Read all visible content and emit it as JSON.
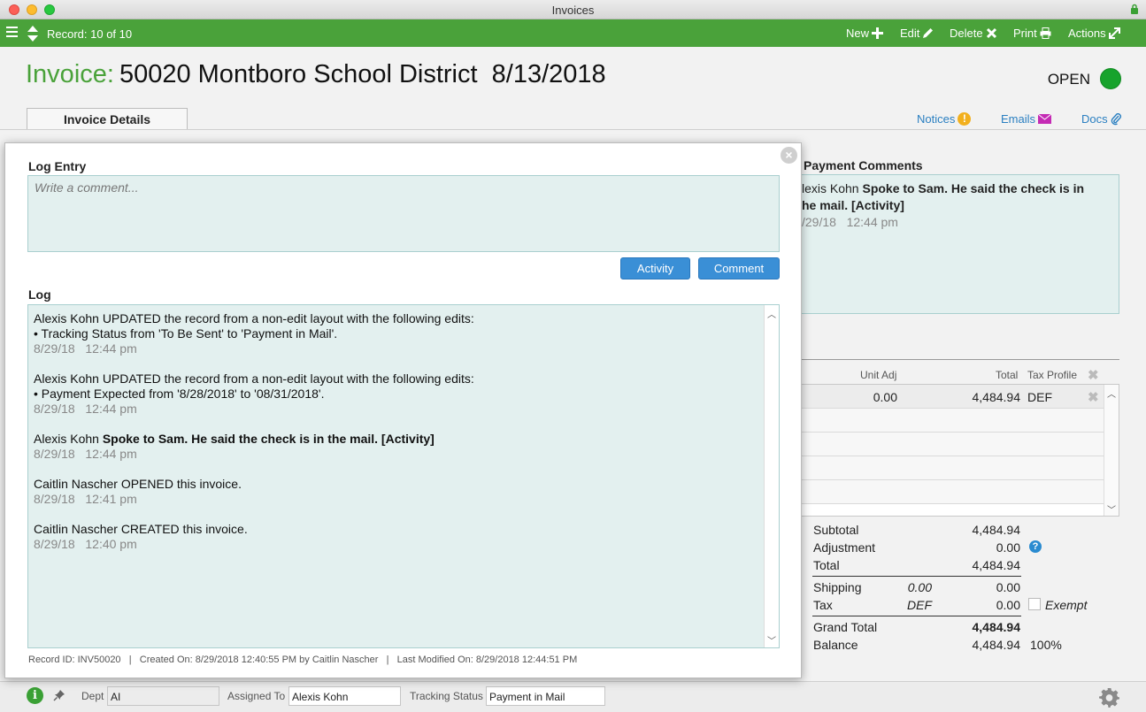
{
  "window": {
    "title": "Invoices"
  },
  "toolbar": {
    "record": "Record: 10 of 10",
    "new_label": "New",
    "edit_label": "Edit",
    "delete_label": "Delete",
    "print_label": "Print",
    "actions_label": "Actions"
  },
  "header": {
    "label": "Invoice:",
    "title": "50020 Montboro School District  8/13/2018",
    "status": "OPEN"
  },
  "tabs": {
    "details": "Invoice Details"
  },
  "links": {
    "notices": "Notices",
    "emails": "Emails",
    "docs": "Docs"
  },
  "payment_comments": {
    "title": "Payment Comments",
    "name": "lexis Kohn",
    "text_line1": "Spoke to Sam. He said the check is in",
    "text_line2": "he mail. [Activity]",
    "date": "/29/18   12:44 pm"
  },
  "line_items": {
    "columns": {
      "unit_adj": "Unit Adj",
      "total": "Total",
      "tax_profile": "Tax Profile"
    },
    "rows": [
      {
        "unit_adj": "0.00",
        "total": "4,484.94",
        "tax_profile": "DEF"
      }
    ]
  },
  "totals": {
    "subtotal_label": "Subtotal",
    "subtotal": "4,484.94",
    "adjustment_label": "Adjustment",
    "adjustment": "0.00",
    "total_label": "Total",
    "total": "4,484.94",
    "shipping_label": "Shipping",
    "shipping_input": "0.00",
    "shipping": "0.00",
    "tax_label": "Tax",
    "tax_profile": "DEF",
    "tax": "0.00",
    "exempt_label": "Exempt",
    "grand_total_label": "Grand Total",
    "grand_total": "4,484.94",
    "balance_label": "Balance",
    "balance": "4,484.94",
    "balance_pct": "100%"
  },
  "bottombar": {
    "dept_label": "Dept",
    "dept_value": "AI",
    "assigned_label": "Assigned To",
    "assigned_value": "Alexis Kohn",
    "tracking_label": "Tracking Status",
    "tracking_value": "Payment in Mail"
  },
  "modal": {
    "log_entry_title": "Log Entry",
    "comment_placeholder": "Write a comment...",
    "activity_button": "Activity",
    "comment_button": "Comment",
    "log_title": "Log",
    "entries": [
      {
        "line1": "Alexis Kohn UPDATED the record from a non-edit layout with the following edits:",
        "line2": "• Tracking Status from 'To Be Sent' to 'Payment in Mail'.",
        "date": "8/29/18   12:44 pm"
      },
      {
        "line1": "Alexis Kohn UPDATED the record from a non-edit layout with the following edits:",
        "line2": "• Payment Expected from '8/28/2018' to '08/31/2018'.",
        "date": "8/29/18   12:44 pm"
      },
      {
        "author": "Alexis Kohn",
        "bold": "Spoke to Sam. He said the check is in the mail. [Activity]",
        "date": "8/29/18   12:44 pm"
      },
      {
        "line1": "Caitlin Nascher OPENED this invoice.",
        "date": "8/29/18   12:41 pm"
      },
      {
        "line1": "Caitlin Nascher CREATED this invoice.",
        "date": "8/29/18   12:40 pm"
      }
    ],
    "footer": "Record ID: INV50020   |   Created On: 8/29/2018 12:40:55 PM by Caitlin Nascher   |   Last Modified On: 8/29/2018 12:44:51 PM"
  },
  "colors": {
    "brand_green": "#4aa23a",
    "link_blue": "#2a7fc1",
    "button_blue": "#3a8fd6",
    "panel_teal": "#e3f0ef"
  }
}
